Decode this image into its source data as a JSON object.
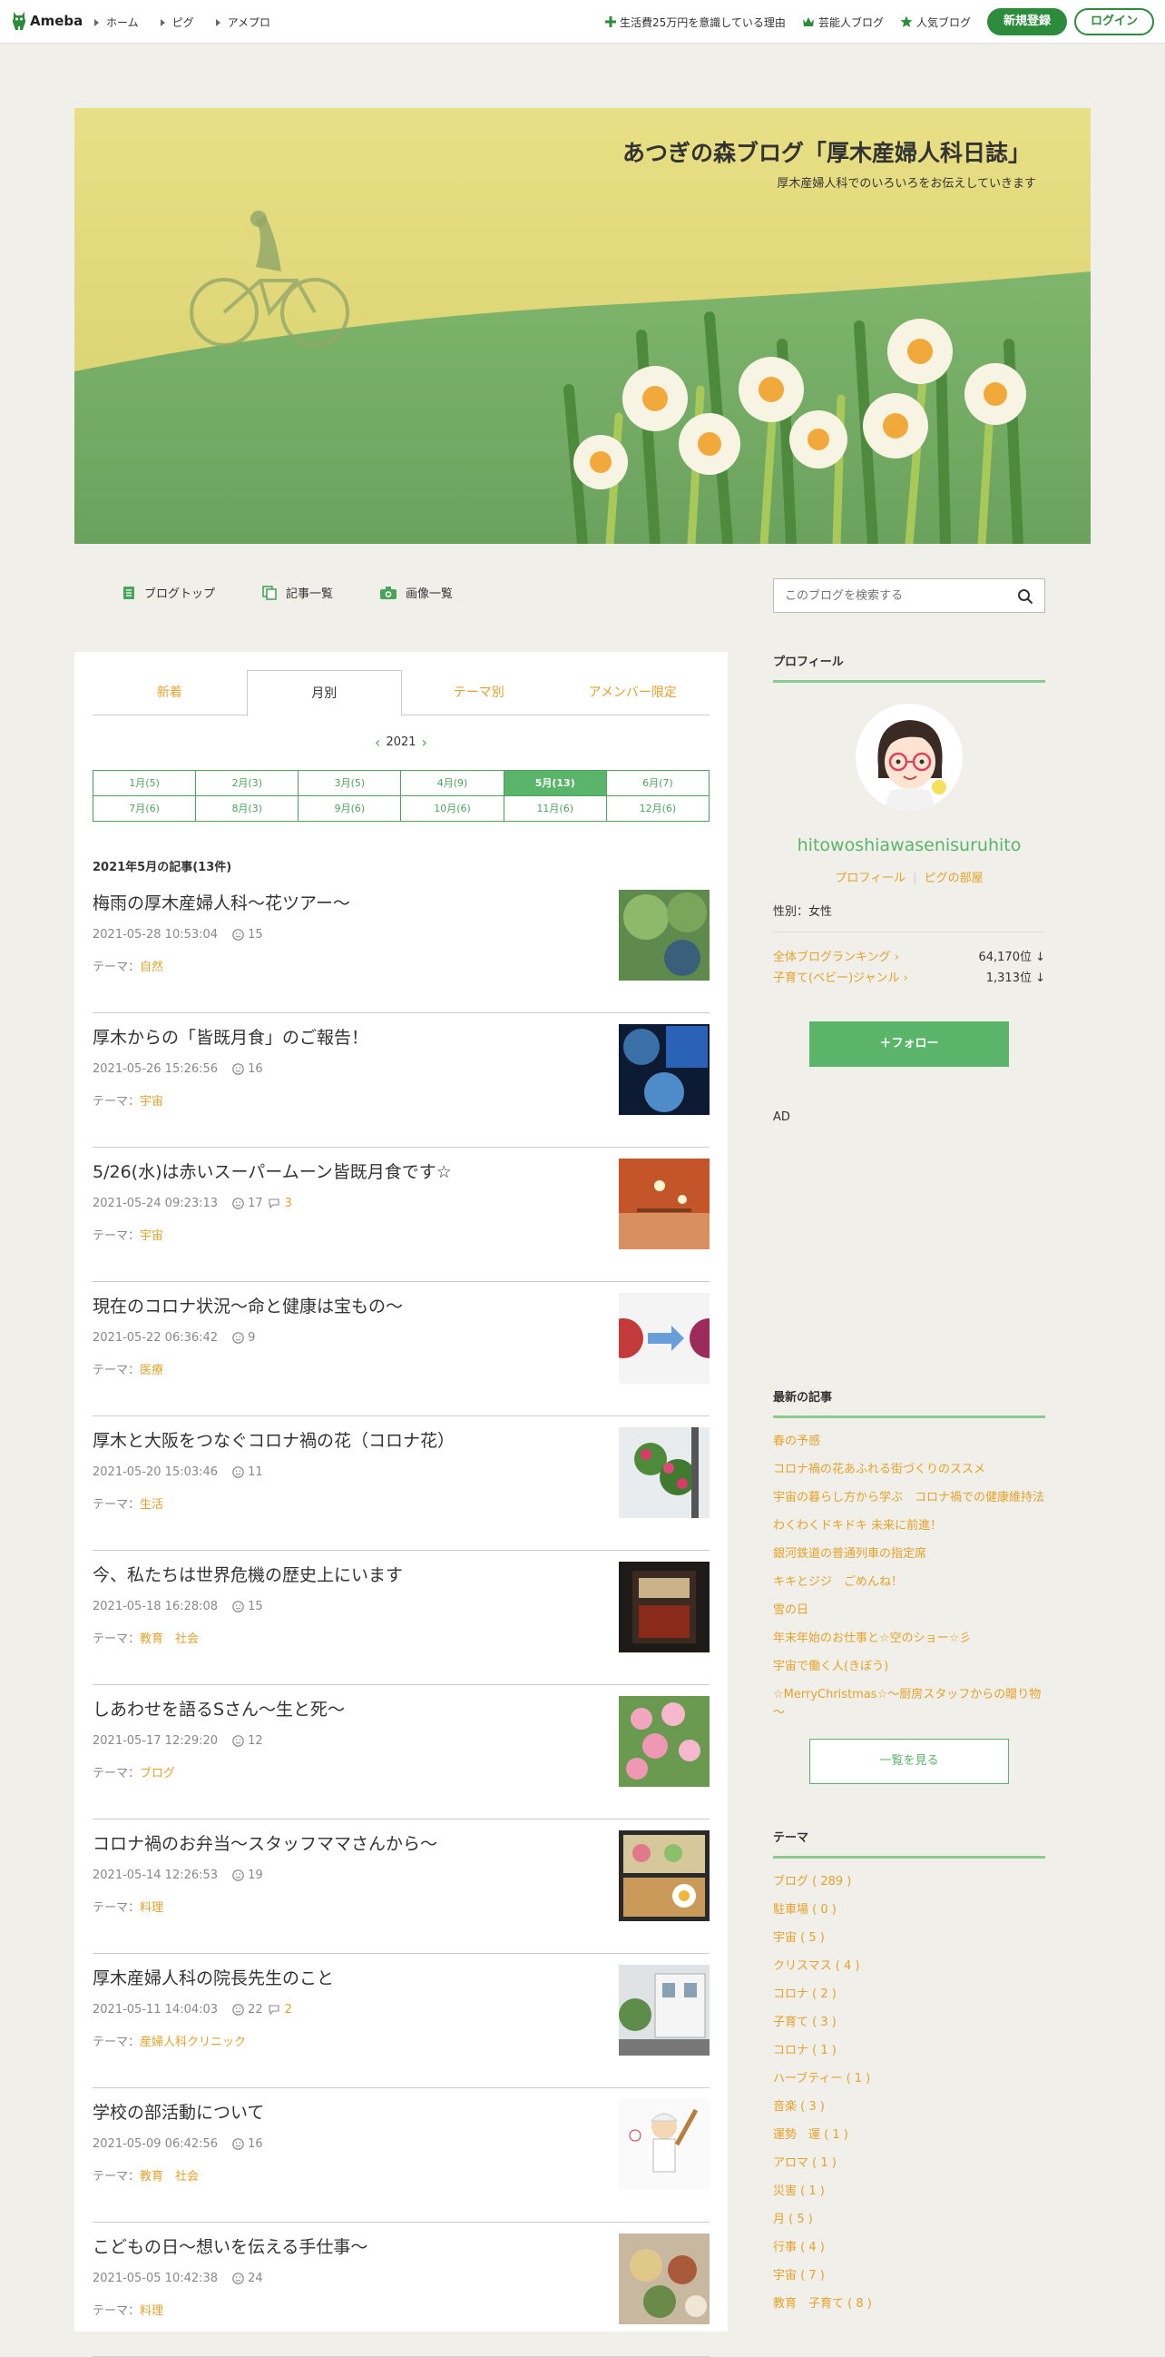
{
  "topbar": {
    "logo_text": "Ameba",
    "left_links": [
      "ホーム",
      "ピグ",
      "アメプロ"
    ],
    "right_links": [
      "生活費25万円を意識している理由",
      "芸能人ブログ",
      "人気ブログ"
    ],
    "signup_label": "新規登録",
    "login_label": "ログイン"
  },
  "header": {
    "title": "あつぎの森ブログ「厚木産婦人科日誌」",
    "subtitle": "厚木産婦人科でのいろいろをお伝えしていきます"
  },
  "subnav": {
    "items": [
      "ブログトップ",
      "記事一覧",
      "画像一覧"
    ],
    "search_placeholder": "このブログを検索する"
  },
  "main": {
    "tabs": [
      "新着",
      "月別",
      "テーマ別",
      "アメンバー限定"
    ],
    "active_tab": "月別",
    "year": "2021",
    "months": [
      "1月(5)",
      "2月(3)",
      "3月(5)",
      "4月(9)",
      "5月(13)",
      "6月(7)",
      "7月(6)",
      "8月(3)",
      "9月(6)",
      "10月(6)",
      "11月(6)",
      "12月(6)"
    ],
    "active_month": "5月(13)",
    "heading": "2021年5月の記事(13件)",
    "theme_prefix": "テーマ：",
    "entries": [
      {
        "title": "梅雨の厚木産婦人科～花ツアー～",
        "date": "2021-05-28 10:53:04",
        "likes": "15",
        "comments": "",
        "theme": "自然"
      },
      {
        "title": "厚木からの「皆既月食」のご報告！",
        "date": "2021-05-26 15:26:56",
        "likes": "16",
        "comments": "",
        "theme": "宇宙"
      },
      {
        "title": "5/26(水)は赤いスーパームーン皆既月食です☆",
        "date": "2021-05-24 09:23:13",
        "likes": "17",
        "comments": "3",
        "theme": "宇宙"
      },
      {
        "title": "現在のコロナ状況～命と健康は宝もの～",
        "date": "2021-05-22 06:36:42",
        "likes": "9",
        "comments": "",
        "theme": "医療"
      },
      {
        "title": "厚木と大阪をつなぐコロナ禍の花（コロナ花）",
        "date": "2021-05-20 15:03:46",
        "likes": "11",
        "comments": "",
        "theme": "生活"
      },
      {
        "title": "今、私たちは世界危機の歴史上にいます",
        "date": "2021-05-18 16:28:08",
        "likes": "15",
        "comments": "",
        "theme": "教育　社会"
      },
      {
        "title": "しあわせを語るSさん～生と死～",
        "date": "2021-05-17 12:29:20",
        "likes": "12",
        "comments": "",
        "theme": "ブログ"
      },
      {
        "title": "コロナ禍のお弁当～スタッフママさんから～",
        "date": "2021-05-14 12:26:53",
        "likes": "19",
        "comments": "",
        "theme": "料理"
      },
      {
        "title": "厚木産婦人科の院長先生のこと",
        "date": "2021-05-11 14:04:03",
        "likes": "22",
        "comments": "2",
        "theme": "産婦人科クリニック"
      },
      {
        "title": "学校の部活動について",
        "date": "2021-05-09 06:42:56",
        "likes": "16",
        "comments": "",
        "theme": "教育　社会"
      },
      {
        "title": "こどもの日～想いを伝える手仕事～",
        "date": "2021-05-05 10:42:38",
        "likes": "24",
        "comments": "",
        "theme": "料理"
      }
    ]
  },
  "side": {
    "profile_heading": "プロフィール",
    "username": "hitowoshiawasenisuruhito",
    "profile_link": "プロフィール",
    "pig_link": "ピグの部屋",
    "gender": "性別：女性",
    "rankings": [
      {
        "label": "全体ブログランキング",
        "value": "64,170位 ↓"
      },
      {
        "label": "子育て(ベビー)ジャンル",
        "value": "1,313位 ↓"
      }
    ],
    "follow_label": "＋フォロー",
    "ad_label": "AD",
    "latest_heading": "最新の記事",
    "latest": [
      "春の予感",
      "コロナ禍の花あふれる街づくりのススメ",
      "宇宙の暮らし方から学ぶ　コロナ禍での健康維持法",
      "わくわくドキドキ 未来に前進！",
      "銀河鉄道の普通列車の指定席",
      "キキとジジ　ごめんね！",
      "雪の日",
      "年末年始のお仕事と☆空のショー☆彡",
      "宇宙で働く人(きぼう)",
      "☆MerryChristmas☆～厨房スタッフからの贈り物～"
    ],
    "view_all_label": "一覧を見る",
    "theme_heading": "テーマ",
    "themes": [
      "ブログ ( 289 )",
      "駐車場 ( 0 )",
      "宇宙 ( 5 )",
      "クリスマス ( 4 )",
      "コロナ ( 2 )",
      "子育て ( 3 )",
      "コロナ ( 1 )",
      "ハーブティー ( 1 )",
      "音楽 ( 3 )",
      "運勢　運 ( 1 )",
      "アロマ ( 1 )",
      "災害 ( 1 )",
      "月 ( 5 )",
      "行事 ( 4 )",
      "宇宙 ( 7 )",
      "教育　子育て ( 8 )"
    ]
  },
  "colors": {
    "accent_green": "#2d8c3c",
    "link_orange": "#e5a229",
    "calendar_green": "#5ab56a"
  }
}
